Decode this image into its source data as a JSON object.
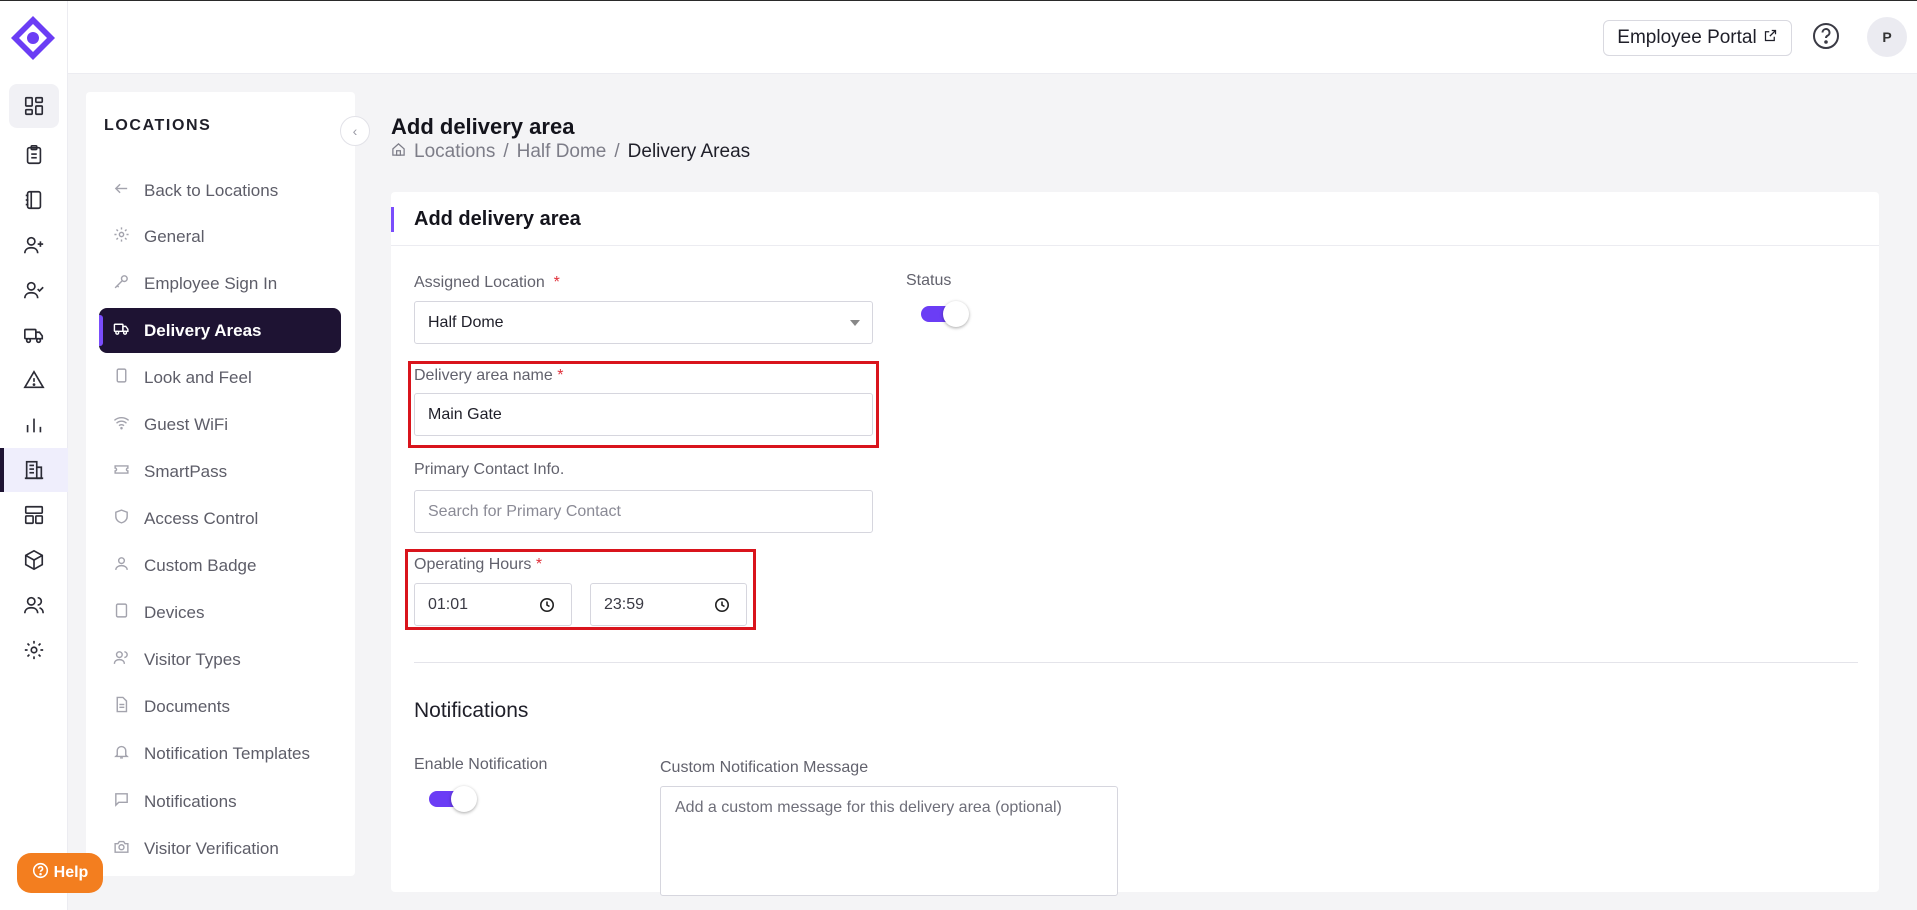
{
  "topbar": {
    "employee_portal_label": "Employee Portal",
    "avatar_initial": "P"
  },
  "rail": {
    "items": [
      "dashboard-icon",
      "clipboard-icon",
      "notebook-icon",
      "user-plus-icon",
      "user-check-icon",
      "truck-icon",
      "warning-icon",
      "bar-chart-icon",
      "building-icon",
      "layout-icon",
      "package-icon",
      "users-icon",
      "gear-icon"
    ],
    "active": "building-icon"
  },
  "subnav": {
    "title": "LOCATIONS",
    "items": [
      {
        "label": "Back to Locations",
        "icon": "arrow-left-icon"
      },
      {
        "label": "General",
        "icon": "gear-icon"
      },
      {
        "label": "Employee Sign In",
        "icon": "key-icon"
      },
      {
        "label": "Delivery Areas",
        "icon": "truck-icon",
        "active": true
      },
      {
        "label": "Look and Feel",
        "icon": "tablet-icon"
      },
      {
        "label": "Guest WiFi",
        "icon": "wifi-icon"
      },
      {
        "label": "SmartPass",
        "icon": "ticket-icon"
      },
      {
        "label": "Access Control",
        "icon": "shield-icon"
      },
      {
        "label": "Custom Badge",
        "icon": "user-icon"
      },
      {
        "label": "Devices",
        "icon": "device-icon"
      },
      {
        "label": "Visitor Types",
        "icon": "users-icon"
      },
      {
        "label": "Documents",
        "icon": "document-icon"
      },
      {
        "label": "Notification Templates",
        "icon": "bell-icon"
      },
      {
        "label": "Notifications",
        "icon": "chat-icon"
      },
      {
        "label": "Visitor Verification",
        "icon": "camera-icon"
      }
    ]
  },
  "page": {
    "title": "Add delivery area",
    "breadcrumb": [
      "Locations",
      "Half Dome",
      "Delivery Areas"
    ],
    "separator": "/"
  },
  "form": {
    "card_title": "Add delivery area",
    "assigned_location_label": "Assigned Location",
    "assigned_location_value": "Half Dome",
    "status_label": "Status",
    "status_on": true,
    "area_name_label": "Delivery area name",
    "area_name_value": "Main Gate",
    "primary_contact_label": "Primary Contact Info.",
    "primary_contact_placeholder": "Search for Primary Contact",
    "operating_hours_label": "Operating Hours",
    "start_time": "01:01",
    "end_time": "23:59",
    "required_mark": "*"
  },
  "notifications": {
    "section_title": "Notifications",
    "enable_label": "Enable Notification",
    "enabled": true,
    "custom_message_label": "Custom Notification Message",
    "custom_message_placeholder": "Add a custom message for this delivery area (optional)"
  },
  "help": {
    "label": "Help"
  },
  "colors": {
    "accent": "#6b3df5",
    "nav_active_bg": "#1e1333",
    "highlight_box": "#d9141c",
    "help_button": "#f37e1f"
  }
}
